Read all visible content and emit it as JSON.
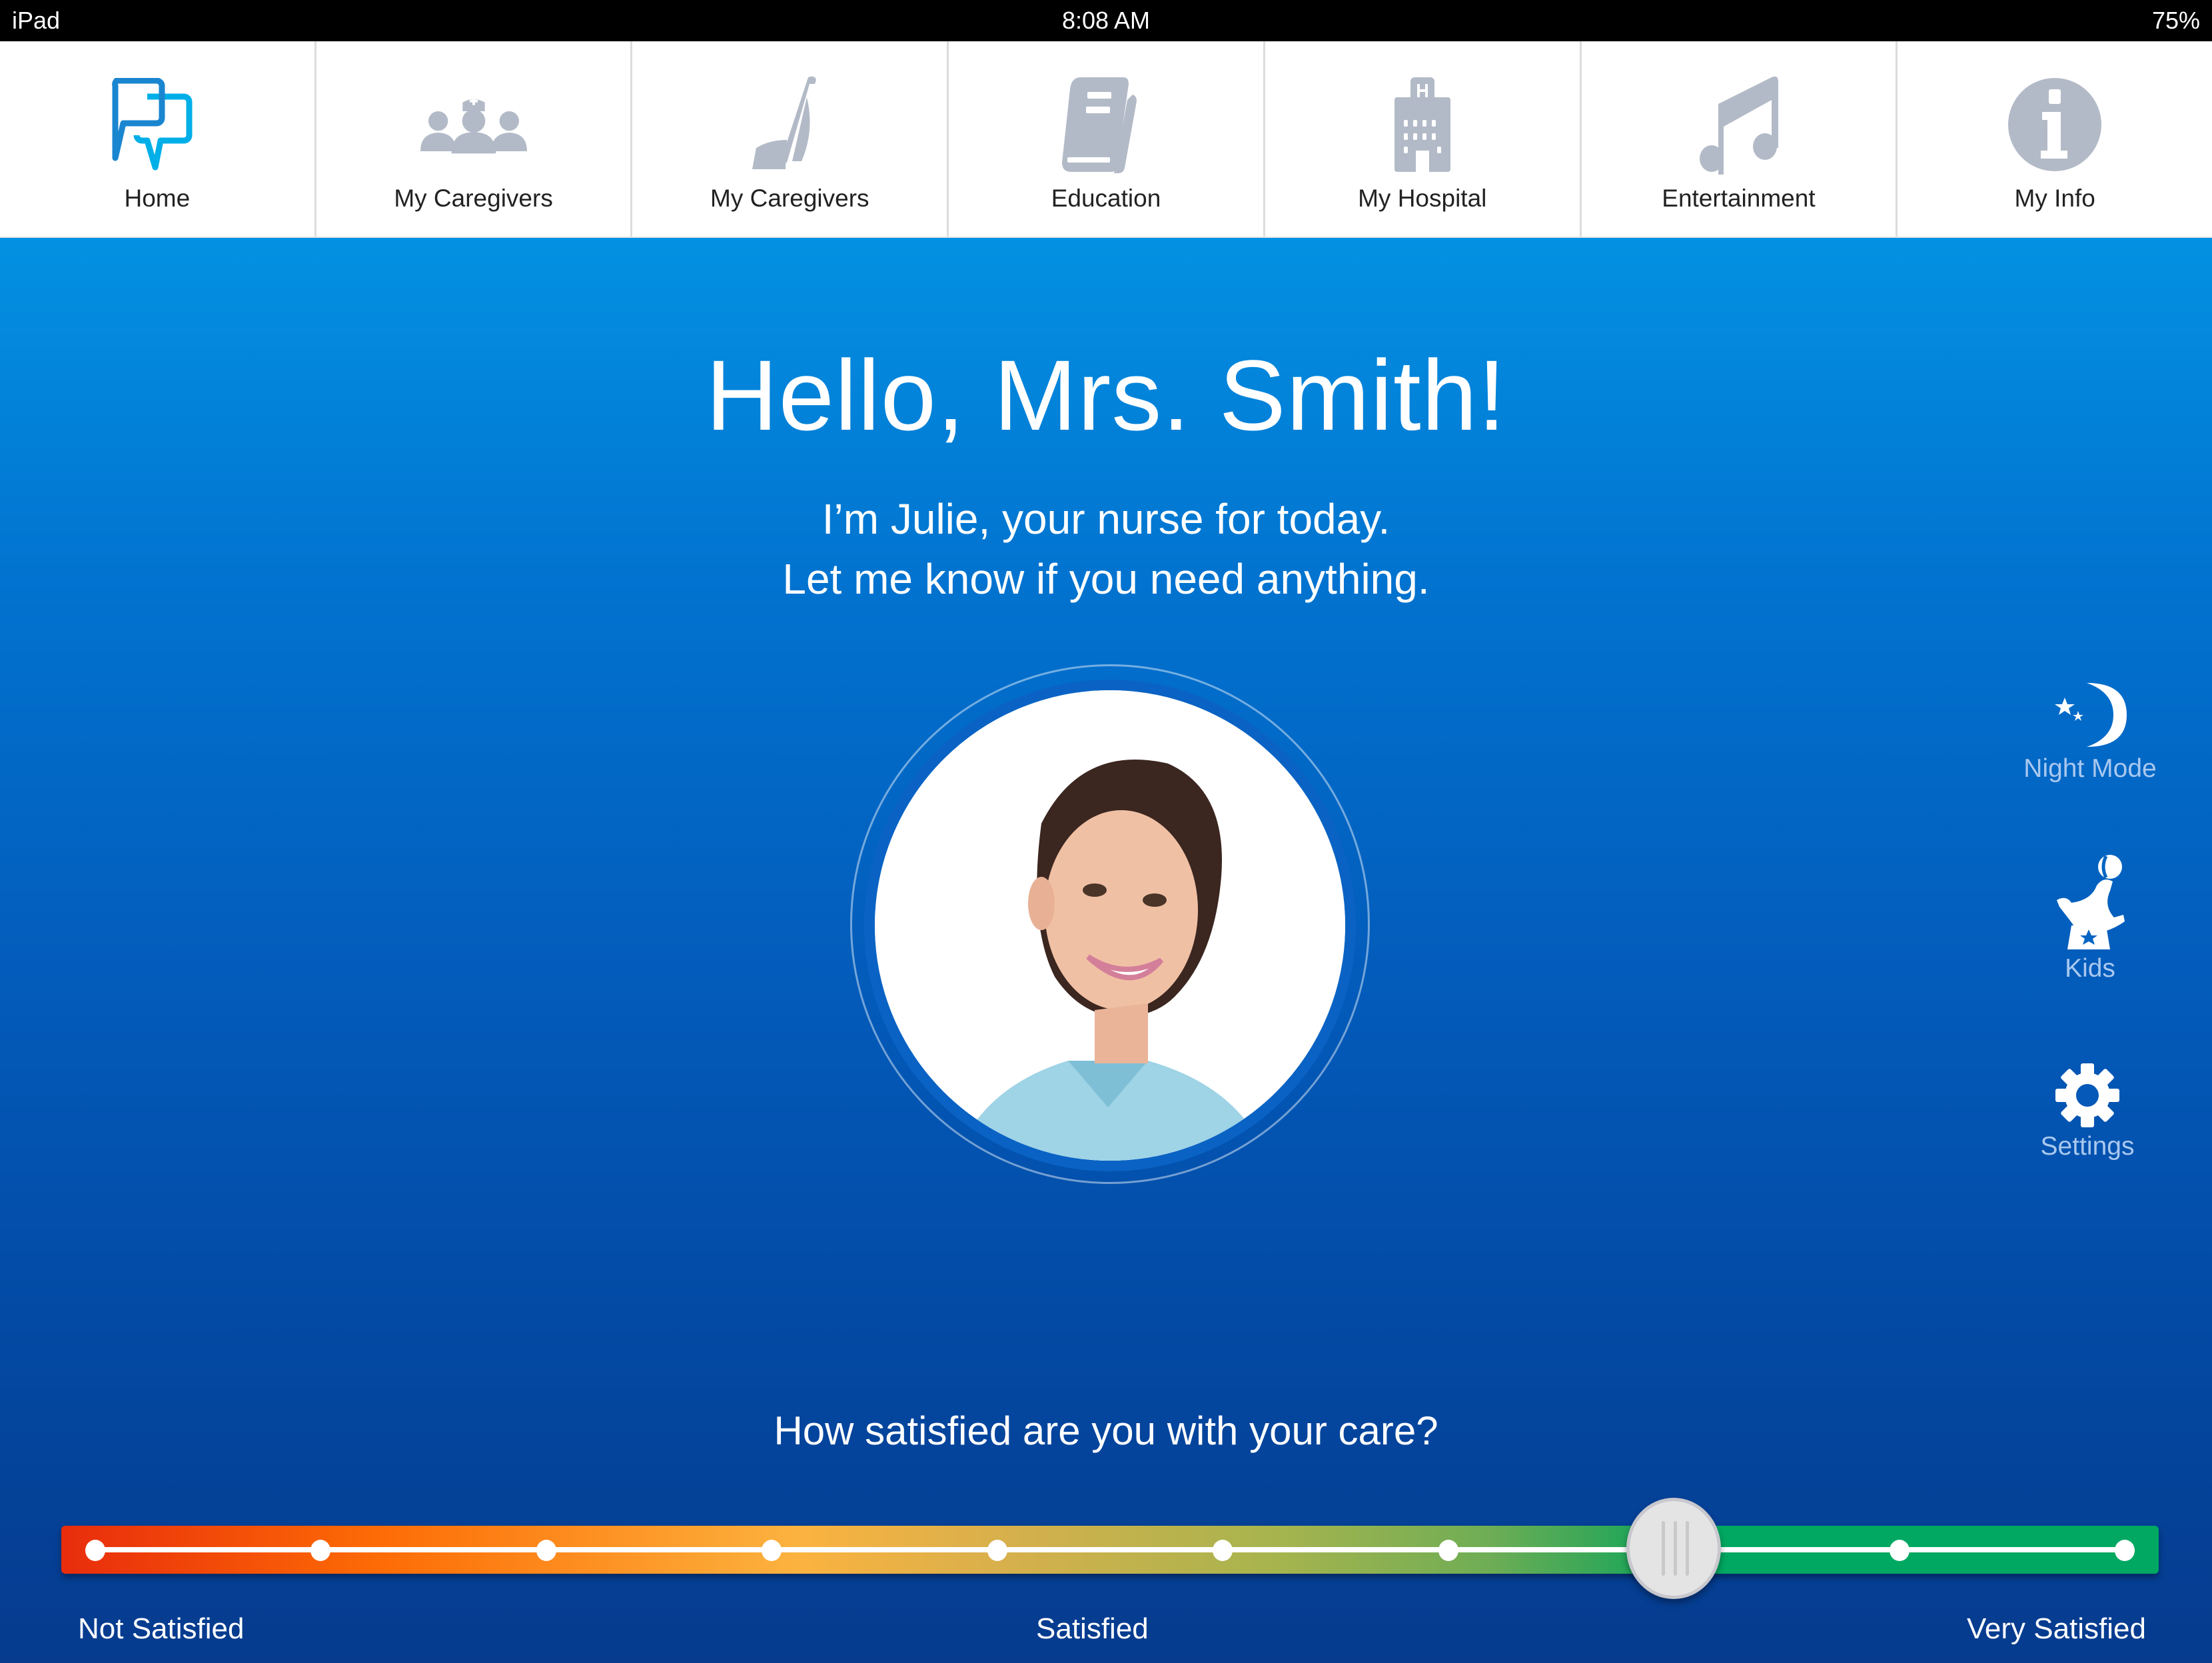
{
  "status_bar": {
    "device": "iPad",
    "time": "8:08 AM",
    "battery": "75%"
  },
  "nav": {
    "items": [
      {
        "label": "Home",
        "icon": "chat-bubbles-icon",
        "active": true
      },
      {
        "label": "My Caregivers",
        "icon": "caregivers-icon",
        "active": false
      },
      {
        "label": "My Caregivers",
        "icon": "vacuum-icon",
        "active": false
      },
      {
        "label": "Education",
        "icon": "book-icon",
        "active": false
      },
      {
        "label": "My Hospital",
        "icon": "hospital-icon",
        "active": false
      },
      {
        "label": "Entertainment",
        "icon": "music-note-icon",
        "active": false
      },
      {
        "label": "My Info",
        "icon": "info-icon",
        "active": false
      }
    ],
    "active_color": "#1a86d0",
    "inactive_color": "#b3bac7"
  },
  "greeting": {
    "title": "Hello, Mrs. Smith!",
    "line1": "I’m Julie, your nurse for today.",
    "line2": "Let me know if you need anything."
  },
  "nurse": {
    "name": "Julie",
    "photo_alt": "Nurse Julie photo"
  },
  "side_buttons": [
    {
      "label": "Night Mode",
      "icon": "moon-stars-icon"
    },
    {
      "label": "Kids",
      "icon": "seal-ball-icon"
    },
    {
      "label": "Settings",
      "icon": "gear-icon"
    }
  ],
  "satisfaction": {
    "question": "How satisfied are you with your care?",
    "stops": 10,
    "selected_stop": 8,
    "labels": {
      "low": "Not Satisfied",
      "mid": "Satisfied",
      "high": "Very Satisfied"
    }
  }
}
